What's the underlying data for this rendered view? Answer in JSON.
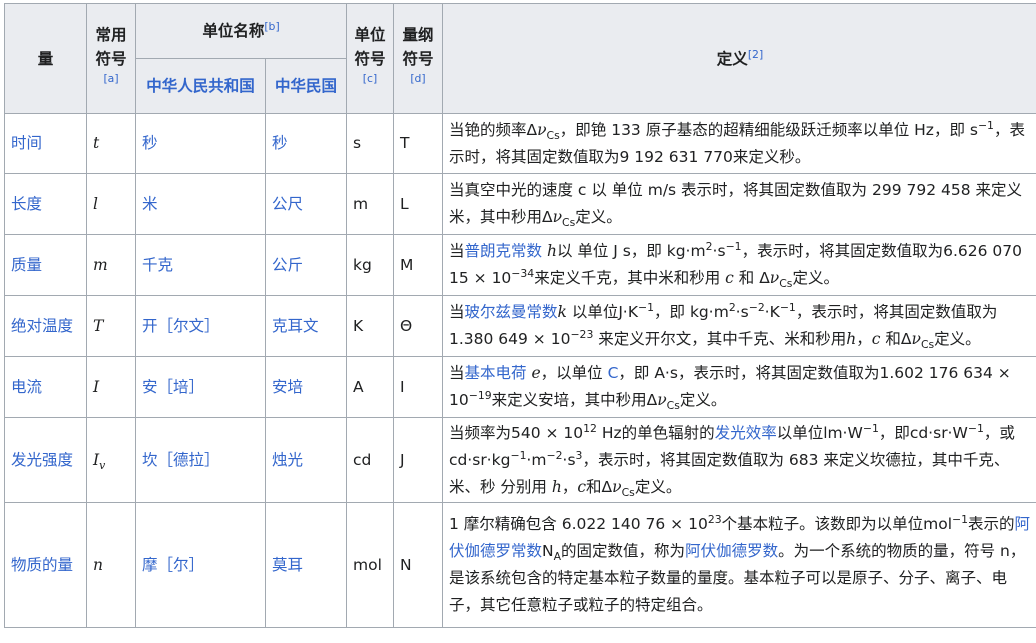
{
  "header": {
    "quantity": "量",
    "symbol": "常用符号",
    "symbol_ref": "[a]",
    "unit_name": "单位名称",
    "unit_name_ref": "[b]",
    "prc": "中华人民共和国",
    "roc": "中华民国",
    "unit_symbol": "单位符号",
    "unit_symbol_ref": "[c]",
    "dim_symbol": "量纲符号",
    "dim_symbol_ref": "[d]",
    "definition": "定义",
    "definition_ref": "[2]"
  },
  "rows": [
    {
      "quantity": "时间",
      "symbol": "t",
      "symbol_sub": "",
      "prc": "秒",
      "roc": "秒",
      "unit": "s",
      "dim": "T",
      "def": {
        "a": "当铯的频率Δ",
        "nu": "ν",
        "cs": "Cs",
        "b": "，即铯 133 原子基态的超精细能级跃迁频率以单位 Hz，即 s",
        "exp": "−1",
        "c": "，表示时，将其固定数值取为9 192 631 770来定义秒。"
      }
    },
    {
      "quantity": "长度",
      "symbol": "l",
      "symbol_sub": "",
      "prc": "米",
      "roc": "公尺",
      "unit": "m",
      "dim": "L",
      "def": {
        "a": "当真空中光的速度 c 以 单位 m/s 表示时，将其固定数值取为 299 792 458 来定义米，其中秒用Δ",
        "nu": "ν",
        "cs": "Cs",
        "b": "定义。"
      }
    },
    {
      "quantity": "质量",
      "symbol": "m",
      "symbol_sub": "",
      "prc": "千克",
      "roc": "公斤",
      "unit": "kg",
      "dim": "M",
      "def": {
        "a": "当",
        "link": "普朗克常数",
        "sym": "h",
        "b": "以 单位 J s，即 kg⋅m",
        "exp1": "2",
        "c": "⋅s",
        "exp2": "−1",
        "d": "，表示时，将其固定数值取为6.626 070 15 × 10",
        "exp3": "−34",
        "e": "来定义千克，其中米和秒用",
        "c_sym": "c",
        "f": "和 Δ",
        "nu": "ν",
        "cs": "Cs",
        "g": "定义。"
      }
    },
    {
      "quantity": "绝对温度",
      "symbol": "T",
      "symbol_sub": "",
      "prc": "开［尔文］",
      "roc": "克耳文",
      "unit": "K",
      "dim": "Θ",
      "def": {
        "a": "当",
        "link": "玻尔兹曼常数",
        "sym": "k",
        "b": " 以单位J⋅K",
        "exp1": "−1",
        "c": "，即 kg⋅m",
        "exp2": "2",
        "d": "⋅s",
        "exp3": "−2",
        "e": "⋅K",
        "exp4": "−1",
        "f": "，表示时，将其固定数值取为1.380 649 × 10",
        "exp5": "−23",
        "g": " 来定义开尔文，其中千克、米和秒用",
        "h_sym": "h",
        "h2": "，",
        "c_sym": "c",
        "i": " 和Δ",
        "nu": "ν",
        "cs": "Cs",
        "j": "定义。"
      }
    },
    {
      "quantity": "电流",
      "symbol": "I",
      "symbol_sub": "",
      "prc": "安［培］",
      "roc": "安培",
      "unit": "A",
      "dim": "I",
      "def": {
        "a": "当",
        "link": "基本电荷",
        "sym": "e",
        "b": "，以单位 ",
        "link2": "C",
        "c": "，即 A⋅s，表示时，将其固定数值取为1.602 176 634 × 10",
        "exp": "−19",
        "d": "来定义安培，其中秒用Δ",
        "nu": "ν",
        "cs": "Cs",
        "e": "定义。"
      }
    },
    {
      "quantity": "发光强度",
      "symbol": "I",
      "symbol_sub": "v",
      "prc": "坎［德拉］",
      "roc": "烛光",
      "unit": "cd",
      "dim": "J",
      "def": {
        "a": "当频率为540 × 10",
        "exp1": "12",
        "b": " Hz的单色辐射的",
        "link": "发光效率",
        "c": "以单位lm⋅W",
        "exp2": "−1",
        "d": "，即cd⋅sr⋅W",
        "exp3": "−1",
        "e": "，或 cd⋅sr⋅kg",
        "exp4": "−1",
        "f": "⋅m",
        "exp5": "−2",
        "g": "⋅s",
        "exp6": "3",
        "h": "，表示时，将其固定数值取为 683 来定义坎德拉，其中千克、米、秒 分别用 ",
        "h_sym": "h",
        "h2": "，",
        "c_sym": "c",
        "i": "和Δ",
        "nu": "ν",
        "cs": "Cs",
        "j": "定义。"
      }
    },
    {
      "quantity": "物质的量",
      "symbol": "n",
      "symbol_sub": "",
      "prc": "摩［尔］",
      "roc": "莫耳",
      "unit": "mol",
      "dim": "N",
      "def": {
        "a": "1 摩尔精确包含 6.022 140 76 × 10",
        "exp1": "23",
        "b": "个基本粒子。该数即为以单位mol",
        "exp2": "−1",
        "c": "表示的",
        "link": "阿伏伽德罗常数",
        "na": "N",
        "na_sub": "A",
        "d": "的固定数值，称为",
        "link2": "阿伏伽德罗数",
        "e": "。为一个系统的物质的量，符号 n，是该系统包含的特定基本粒子数量的量度。基本粒子可以是原子、分子、离子、电子，其它任意粒子或粒子的特定组合。"
      }
    }
  ]
}
